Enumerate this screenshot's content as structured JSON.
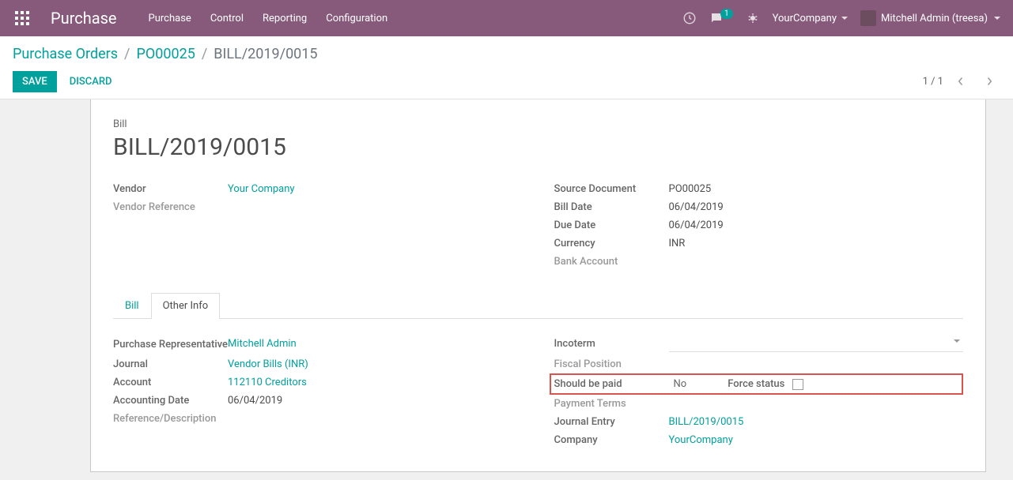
{
  "topbar": {
    "app_name": "Purchase",
    "menu": [
      "Purchase",
      "Control",
      "Reporting",
      "Configuration"
    ],
    "msg_count": "1",
    "company": "YourCompany",
    "user": "Mitchell Admin (treesa)"
  },
  "breadcrumb": {
    "root": "Purchase Orders",
    "parent": "PO00025",
    "current": "BILL/2019/0015"
  },
  "actions": {
    "save": "SAVE",
    "discard": "DISCARD"
  },
  "pager": {
    "text": "1 / 1"
  },
  "title": {
    "label": "Bill",
    "value": "BILL/2019/0015"
  },
  "left_fields": {
    "vendor_label": "Vendor",
    "vendor_value": "Your Company",
    "vendor_ref_label": "Vendor Reference"
  },
  "right_fields": {
    "source_label": "Source Document",
    "source_value": "PO00025",
    "billdate_label": "Bill Date",
    "billdate_value": "06/04/2019",
    "duedate_label": "Due Date",
    "duedate_value": "06/04/2019",
    "currency_label": "Currency",
    "currency_value": "INR",
    "bank_label": "Bank Account"
  },
  "tabs": {
    "bill": "Bill",
    "other": "Other Info"
  },
  "other_left": {
    "rep_label": "Purchase Representative",
    "rep_value": "Mitchell Admin",
    "journal_label": "Journal",
    "journal_value": "Vendor Bills (INR)",
    "account_label": "Account",
    "account_value": "112110 Creditors",
    "accdate_label": "Accounting Date",
    "accdate_value": "06/04/2019",
    "refdesc_label": "Reference/Description"
  },
  "other_right": {
    "incoterm_label": "Incoterm",
    "fiscal_label": "Fiscal Position",
    "shouldpay_label": "Should be paid",
    "shouldpay_value": "No",
    "force_label": "Force status",
    "payterms_label": "Payment Terms",
    "journalentry_label": "Journal Entry",
    "journalentry_value": "BILL/2019/0015",
    "company_label": "Company",
    "company_value": "YourCompany"
  }
}
